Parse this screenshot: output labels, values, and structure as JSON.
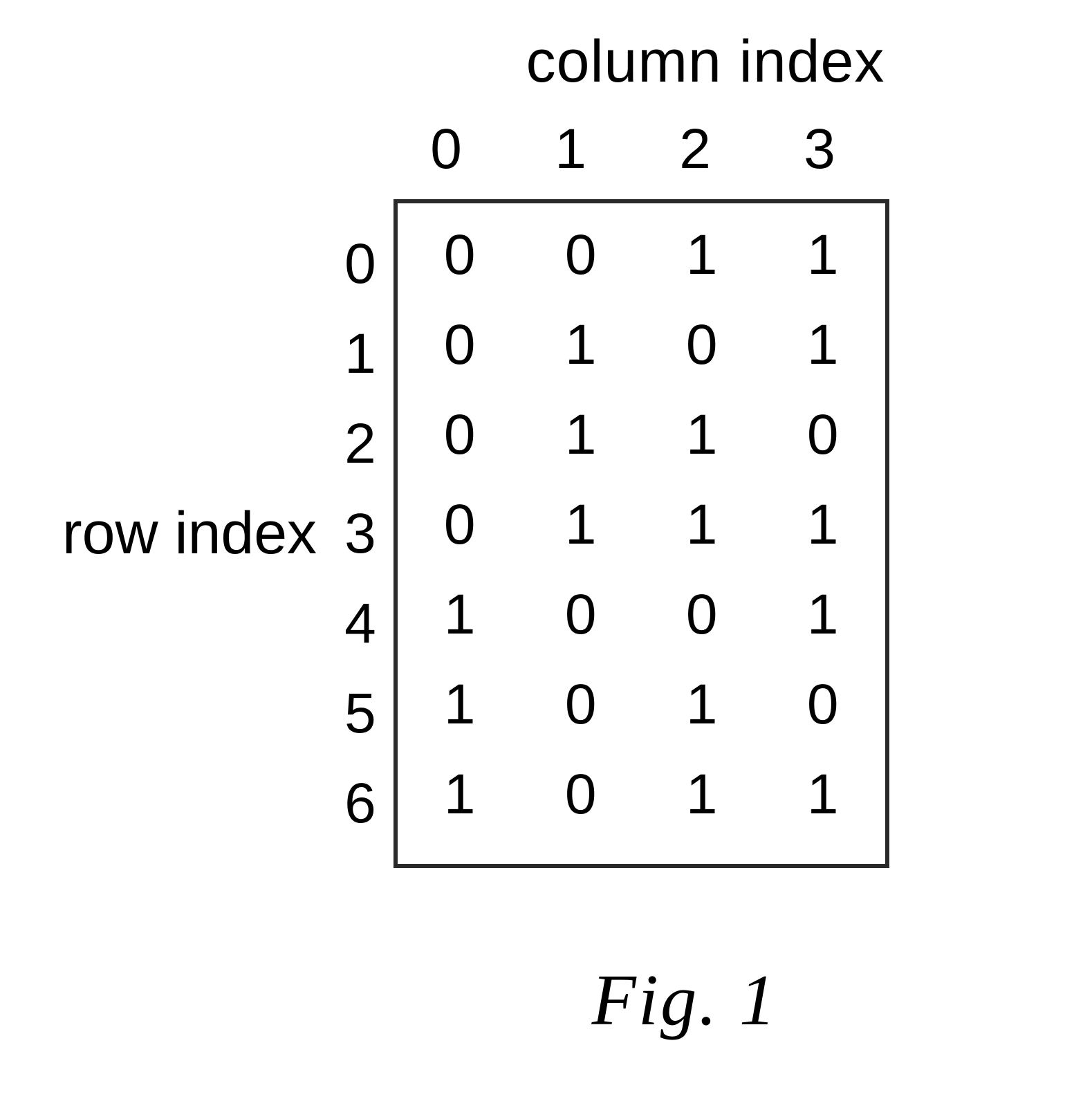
{
  "chart_data": {
    "type": "table",
    "title_column": "column index",
    "title_row": "row index",
    "column_indices": [
      "0",
      "1",
      "2",
      "3"
    ],
    "row_indices": [
      "0",
      "1",
      "2",
      "3",
      "4",
      "5",
      "6"
    ],
    "matrix": [
      [
        "0",
        "0",
        "1",
        "1"
      ],
      [
        "0",
        "1",
        "0",
        "1"
      ],
      [
        "0",
        "1",
        "1",
        "0"
      ],
      [
        "0",
        "1",
        "1",
        "1"
      ],
      [
        "1",
        "0",
        "0",
        "1"
      ],
      [
        "1",
        "0",
        "1",
        "0"
      ],
      [
        "1",
        "0",
        "1",
        "1"
      ]
    ],
    "caption": "Fig. 1"
  }
}
